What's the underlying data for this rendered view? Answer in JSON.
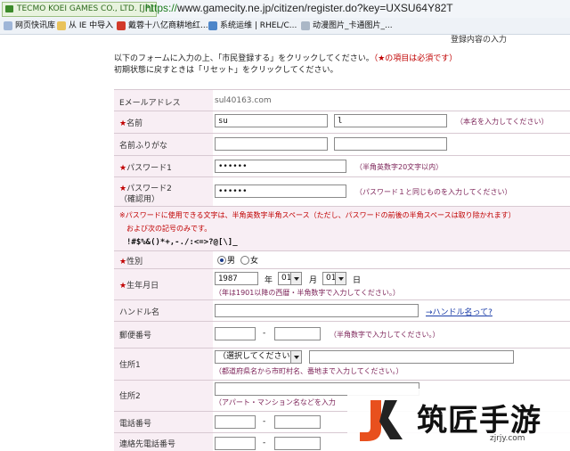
{
  "browser": {
    "site_identity": "TECMO KOEI GAMES CO., LTD. [JP]",
    "url_scheme": "https://",
    "url_rest": "www.gamecity.ne.jp/citizen/register.do?key=UXSU64Y82T",
    "bookmarks": [
      {
        "label": "网页快讯库",
        "icon": "page-icon"
      },
      {
        "label": "从 IE 中导入",
        "icon": "folder-icon"
      },
      {
        "label": "戴蓉十八亿商耕地红...",
        "icon": "red-circle-icon"
      },
      {
        "label": "系统运维 | RHEL/C...",
        "icon": "globe-icon"
      },
      {
        "label": "动漫图片_卡通图片_...",
        "icon": "doc-icon"
      }
    ]
  },
  "page": {
    "sub_title": "登録内容の入力",
    "intro_line1": "以下のフォームに入力の上、「市民登録する」をクリックしてください。",
    "intro_line1_note": "（★の項目は必須です）",
    "intro_line2": "初期状態に戻すときは「リセット」をクリックしてください。"
  },
  "form": {
    "email": {
      "label": "Eメールアドレス",
      "value": "sul40163.com"
    },
    "name": {
      "star": "★",
      "label": "名前",
      "first": "su",
      "last": "l",
      "note": "（本名を入力してください）"
    },
    "name_kana": {
      "label": "名前ふりがな",
      "first": "",
      "last": ""
    },
    "password1": {
      "star": "★",
      "label": "パスワード1",
      "value": "••••••",
      "note": "（半角英数字20文字以内）"
    },
    "password2": {
      "star": "★",
      "label": "パスワード2",
      "sub": "（確認用）",
      "value": "••••••",
      "note": "（パスワード１と同じものを入力してください）"
    },
    "warning": {
      "line1": "※パスワードに使用できる文字は、半角英数字半角スペース（ただし、パスワードの前後の半角スペースは取り除かれます）",
      "line2": "および次の記号のみです。",
      "symbols": "!#$%&()*+,-./:<=>?@[\\]_"
    },
    "gender": {
      "star": "★",
      "label": "性別",
      "male": "男",
      "female": "女",
      "selected": "male"
    },
    "birthday": {
      "star": "★",
      "label": "生年月日",
      "year": "1987",
      "year_unit": "年",
      "month": "01",
      "month_unit": "月",
      "day": "01",
      "day_unit": "日",
      "note": "（年は1901以降の西暦・半角数字で入力してください。）"
    },
    "handle": {
      "label": "ハンドル名",
      "value": "",
      "link": "→ハンドル名って?"
    },
    "postal": {
      "label": "郵便番号",
      "dash": "-",
      "note": "（半角数字で入力してください。）"
    },
    "address1": {
      "label": "住所1",
      "select": "（選択してください）",
      "note": "（都道府県名から市町村名、番地まで入力してください。）"
    },
    "address2": {
      "label": "住所2",
      "note": "（アパート・マンション名などを入力"
    },
    "phone": {
      "label": "電話番号",
      "dash": "-"
    },
    "contact_phone": {
      "label": "連絡先電話番号",
      "dash": "-"
    }
  },
  "watermark": {
    "title": "筑匠手游",
    "url": "zjrjy.com",
    "logo_letters": "JK"
  },
  "colors": {
    "required_red": "#c00000",
    "label_bg": "#f8eef4",
    "note_purple": "#7a1f55"
  }
}
